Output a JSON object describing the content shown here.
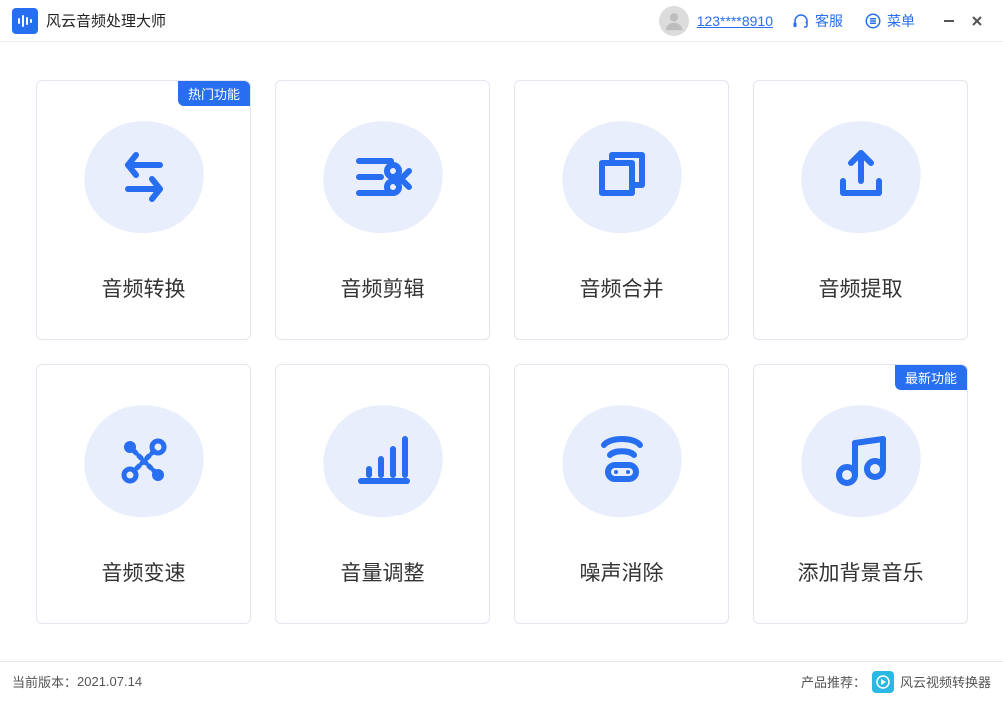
{
  "app": {
    "title": "风云音频处理大师"
  },
  "header": {
    "user_id": "123****8910",
    "support_label": "客服",
    "menu_label": "菜单"
  },
  "badges": {
    "hot": "热门功能",
    "new": "最新功能"
  },
  "cards": [
    {
      "label": "音频转换"
    },
    {
      "label": "音频剪辑"
    },
    {
      "label": "音频合并"
    },
    {
      "label": "音频提取"
    },
    {
      "label": "音频变速"
    },
    {
      "label": "音量调整"
    },
    {
      "label": "噪声消除"
    },
    {
      "label": "添加背景音乐"
    }
  ],
  "footer": {
    "version_label": "当前版本：",
    "version_value": "2021.07.14",
    "recommend_label": "产品推荐：",
    "product_name": "风云视频转换器"
  }
}
